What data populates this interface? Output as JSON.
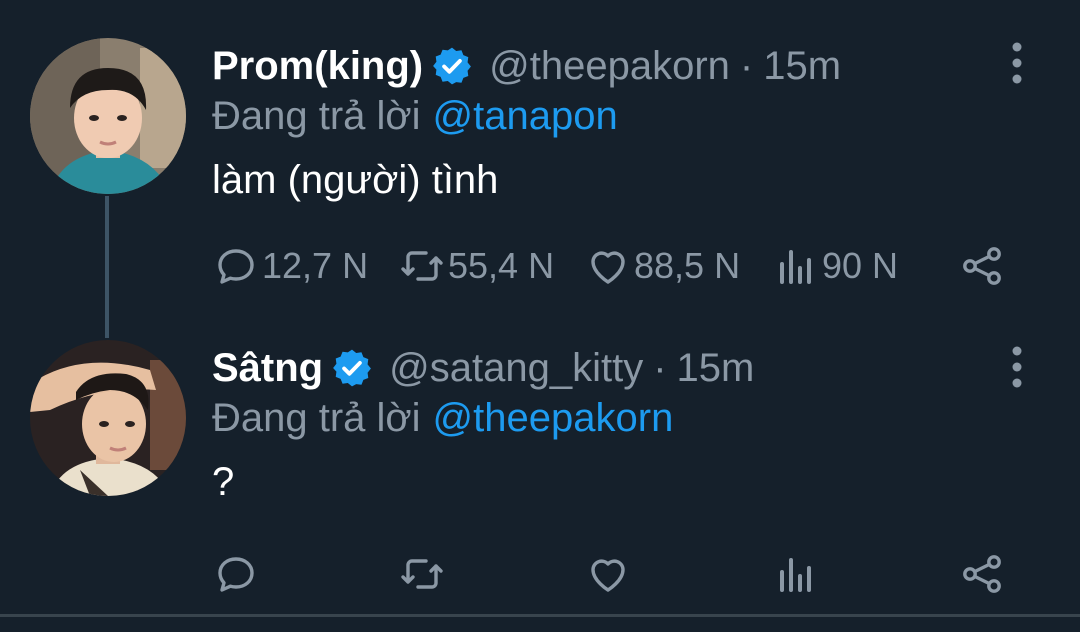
{
  "colors": {
    "background": "#15202b",
    "text_primary": "#ffffff",
    "text_secondary": "#8b98a5",
    "accent": "#1d9bf0",
    "thread_line": "#3d5466"
  },
  "tweets": [
    {
      "display_name": "Prom(king)",
      "verified_icon": "verified-badge-icon",
      "handle": "@theepakorn",
      "separator": "·",
      "time": "15m",
      "reply_prefix": "Đang trả lời",
      "reply_to": "@tanapon",
      "text": "làm (người) tình",
      "metrics": {
        "replies": "12,7 N",
        "retweets": "55,4 N",
        "likes": "88,5 N",
        "views": "90 N"
      }
    },
    {
      "display_name": "Sâtng",
      "verified_icon": "verified-badge-icon",
      "handle": "@satang_kitty",
      "separator": "·",
      "time": "15m",
      "reply_prefix": "Đang trả lời",
      "reply_to": "@theepakorn",
      "text": "?",
      "metrics": {
        "replies": "",
        "retweets": "",
        "likes": "",
        "views": ""
      }
    }
  ]
}
